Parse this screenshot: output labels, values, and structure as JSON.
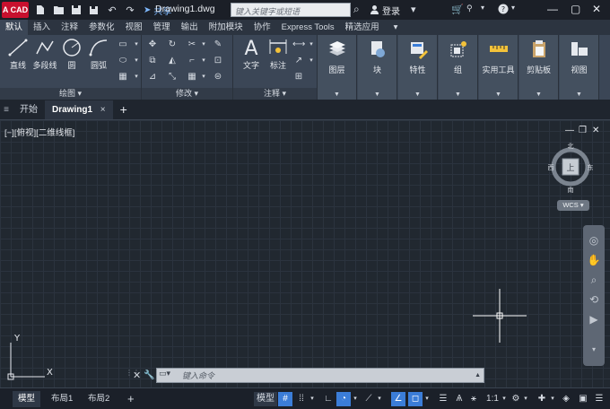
{
  "titlebar": {
    "logo_text": "A CAD",
    "share_label": "共享",
    "doc_title": "Drawing1.dwg",
    "search_placeholder": "键入关键字或短语",
    "login_label": "登录"
  },
  "ribbon_tabs": [
    {
      "label": "默认",
      "active": true
    },
    {
      "label": "插入"
    },
    {
      "label": "注释"
    },
    {
      "label": "参数化"
    },
    {
      "label": "视图"
    },
    {
      "label": "管理"
    },
    {
      "label": "输出"
    },
    {
      "label": "附加模块"
    },
    {
      "label": "协作"
    },
    {
      "label": "Express Tools"
    },
    {
      "label": "精选应用"
    }
  ],
  "ribbon": {
    "draw": {
      "footer": "绘图",
      "buttons": [
        "直线",
        "多段线",
        "圆",
        "圆弧"
      ]
    },
    "modify": {
      "footer": "修改"
    },
    "annotation": {
      "footer": "注释",
      "buttons": [
        "文字",
        "标注"
      ]
    },
    "panels": [
      "图层",
      "块",
      "特性",
      "组",
      "实用工具",
      "剪贴板",
      "视图"
    ]
  },
  "filetabs": {
    "start": "开始",
    "drawing": "Drawing1",
    "close": "×",
    "add": "+"
  },
  "canvas": {
    "viewport_label": "[−][俯视][二维线框]",
    "viewcube": {
      "top": "上",
      "north": "北",
      "south": "南",
      "east": "东",
      "west": "西"
    },
    "wcs_label": "WCS",
    "ucs": {
      "x": "X",
      "y": "Y"
    }
  },
  "command": {
    "placeholder": "键入命令"
  },
  "statusbar": {
    "tabs": [
      {
        "label": "模型",
        "active": true
      },
      {
        "label": "布局1"
      },
      {
        "label": "布局2"
      }
    ],
    "add": "+",
    "model_label": "模型",
    "scale_label": "1:1"
  },
  "colors": {
    "accent": "#3b7dd8",
    "logo": "#c8102e",
    "ribbon_bg": "#3b4656",
    "canvas_bg": "#212830"
  }
}
